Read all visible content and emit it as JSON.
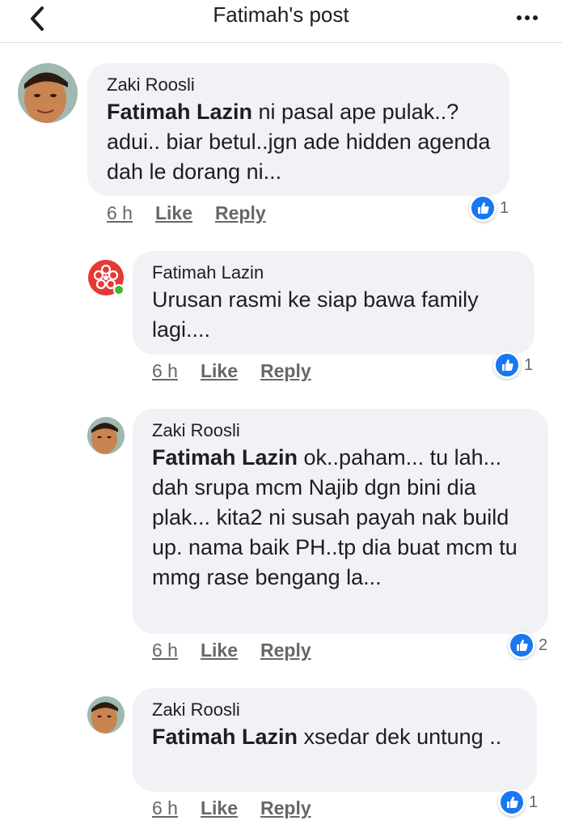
{
  "header": {
    "title": "Fatimah's post",
    "back_icon": "back-chevron-icon",
    "more_icon": "more-dots-icon"
  },
  "comments": [
    {
      "author": "Zaki Roosli",
      "tag": "Fatimah Lazin",
      "text": " ni pasal ape pulak..? adui.. biar betul..jgn ade hidden agenda dah le dorang ni...",
      "time": "6 h",
      "like": "Like",
      "reply": "Reply",
      "reactions": "1"
    },
    {
      "author": "Fatimah Lazin",
      "tag": "",
      "text": "Urusan rasmi ke siap bawa family lagi....",
      "time": "6 h",
      "like": "Like",
      "reply": "Reply",
      "reactions": "1"
    },
    {
      "author": "Zaki Roosli",
      "tag": "Fatimah Lazin",
      "text": " ok..paham... tu lah... dah srupa mcm Najib dgn bini dia plak... kita2 ni susah payah nak build up. nama baik PH..tp dia buat mcm tu mmg rase bengang la...",
      "time": "6 h",
      "like": "Like",
      "reply": "Reply",
      "reactions": "2"
    },
    {
      "author": "Zaki Roosli",
      "tag": "Fatimah Lazin",
      "text": " xsedar dek untung ..",
      "time": "6 h",
      "like": "Like",
      "reply": "Reply",
      "reactions": "1"
    }
  ],
  "colors": {
    "accent": "#1877f2",
    "bubble": "#f0f2f5",
    "meta": "#65676b"
  }
}
